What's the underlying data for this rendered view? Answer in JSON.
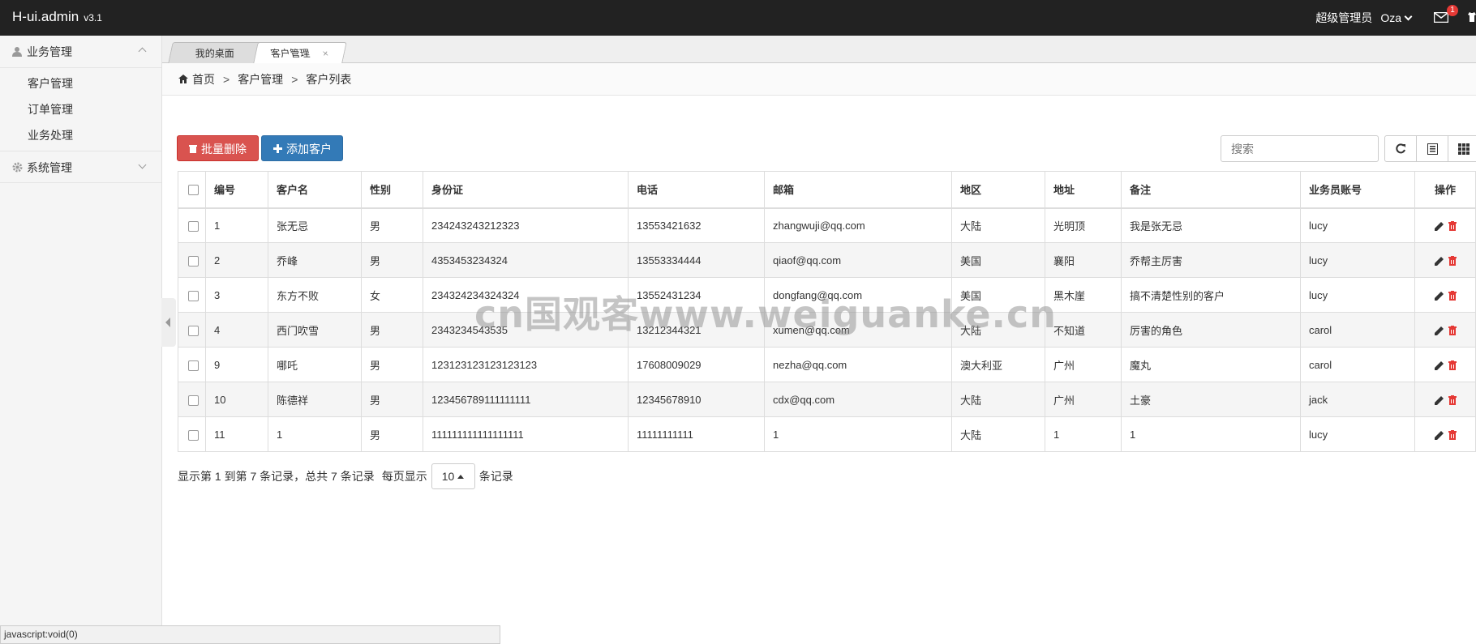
{
  "app": {
    "brand": "H-ui.admin",
    "version": "v3.1"
  },
  "topbar": {
    "role": "超级管理员",
    "user": "Oza",
    "mail_badge": "1"
  },
  "sidebar": {
    "groups": [
      {
        "label": "业务管理",
        "items": [
          "客户管理",
          "订单管理",
          "业务处理"
        ]
      },
      {
        "label": "系统管理"
      }
    ]
  },
  "tabs": [
    {
      "label": "我的桌面"
    },
    {
      "label": "客户管理",
      "close": "×"
    }
  ],
  "breadcrumb": {
    "home": "首页",
    "sep": ">",
    "level2": "客户管理",
    "level3": "客户列表"
  },
  "toolbar": {
    "batch_delete": "批量删除",
    "add_customer": "添加客户",
    "search_placeholder": "搜索"
  },
  "table": {
    "headers": [
      "编号",
      "客户名",
      "性别",
      "身份证",
      "电话",
      "邮箱",
      "地区",
      "地址",
      "备注",
      "业务员账号",
      "操作"
    ],
    "rows": [
      [
        "1",
        "张无忌",
        "男",
        "234243243212323",
        "13553421632",
        "zhangwuji@qq.com",
        "大陆",
        "光明顶",
        "我是张无忌",
        "lucy"
      ],
      [
        "2",
        "乔峰",
        "男",
        "4353453234324",
        "13553334444",
        "qiaof@qq.com",
        "美国",
        "襄阳",
        "乔帮主厉害",
        "lucy"
      ],
      [
        "3",
        "东方不败",
        "女",
        "234324234324324",
        "13552431234",
        "dongfang@qq.com",
        "美国",
        "黑木崖",
        "搞不清楚性别的客户",
        "lucy"
      ],
      [
        "4",
        "西门吹雪",
        "男",
        "2343234543535",
        "13212344321",
        "xumen@qq.com",
        "大陆",
        "不知道",
        "厉害的角色",
        "carol"
      ],
      [
        "9",
        "哪吒",
        "男",
        "123123123123123123",
        "17608009029",
        "nezha@qq.com",
        "澳大利亚",
        "广州",
        "魔丸",
        "carol"
      ],
      [
        "10",
        "陈德祥",
        "男",
        "123456789111111111",
        "12345678910",
        "cdx@qq.com",
        "大陆",
        "广州",
        "土豪",
        "jack"
      ],
      [
        "11",
        "1",
        "男",
        "111111111111111111",
        "11111111111",
        "1",
        "大陆",
        "1",
        "1",
        "lucy"
      ]
    ]
  },
  "pagination": {
    "info": "显示第 1 到第 7 条记录，总共 7 条记录",
    "per_page_prefix": "每页显示",
    "page_size": "10",
    "per_page_suffix": "条记录"
  },
  "statusbar": {
    "text": "javascript:void(0)"
  },
  "watermark": {
    "text": "cn国观客www.weiguanke.cn"
  },
  "colors": {
    "topbar": "#222222",
    "danger": "#d9534f",
    "primary": "#337ab7",
    "delete_icon": "#e53935"
  }
}
